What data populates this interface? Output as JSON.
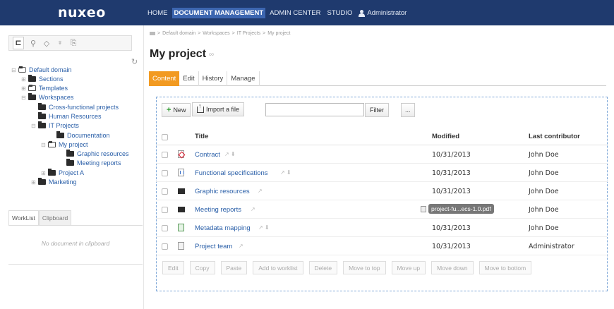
{
  "brand": "nuxeo",
  "topnav": {
    "items": [
      "HOME",
      "DOCUMENT MANAGEMENT",
      "ADMIN CENTER",
      "STUDIO"
    ],
    "active": "DOCUMENT MANAGEMENT",
    "user": "Administrator"
  },
  "tree_tabs": [
    "tree-icon",
    "search-icon",
    "tag-icon",
    "pin-icon",
    "clipboard-icon"
  ],
  "tree": [
    {
      "label": "Default domain",
      "depth": 0
    },
    {
      "label": "Sections",
      "depth": 1
    },
    {
      "label": "Templates",
      "depth": 1
    },
    {
      "label": "Workspaces",
      "depth": 1
    },
    {
      "label": "Cross-functional projects",
      "depth": 2
    },
    {
      "label": "Human Resources",
      "depth": 2
    },
    {
      "label": "IT Projects",
      "depth": 2
    },
    {
      "label": "Documentation",
      "depth": 3
    },
    {
      "label": "My project",
      "depth": 3
    },
    {
      "label": "Graphic resources",
      "depth": 4
    },
    {
      "label": "Meeting reports",
      "depth": 4
    },
    {
      "label": "Project A",
      "depth": 3
    },
    {
      "label": "Marketing",
      "depth": 2
    }
  ],
  "worklist": {
    "tabs": [
      "WorkList",
      "Clipboard"
    ],
    "empty_text": "No document in clipboard"
  },
  "breadcrumb": [
    "Default domain",
    "Workspaces",
    "IT Projects",
    "My project"
  ],
  "page_title": "My project",
  "doc_tabs": [
    "Content",
    "Edit",
    "History",
    "Manage"
  ],
  "toolbar": {
    "new_label": "New",
    "import_label": "Import a file",
    "filter_placeholder": "",
    "filter_label": "Filter",
    "more_label": "..."
  },
  "table": {
    "columns": [
      "Title",
      "Modified",
      "Last contributor"
    ],
    "rows": [
      {
        "title": "Contract",
        "type": "pdf",
        "modified": "10/31/2013",
        "contributor": "John Doe"
      },
      {
        "title": "Functional specifications",
        "type": "doc",
        "modified": "10/31/2013",
        "contributor": "John Doe"
      },
      {
        "title": "Graphic resources",
        "type": "folder",
        "modified": "10/31/2013",
        "contributor": "John Doe"
      },
      {
        "title": "Meeting reports",
        "type": "folder",
        "modified": "",
        "contributor": "John Doe"
      },
      {
        "title": "Metadata mapping",
        "type": "meta",
        "modified": "10/31/2013",
        "contributor": "John Doe"
      },
      {
        "title": "Project team",
        "type": "team",
        "modified": "10/31/2013",
        "contributor": "Administrator"
      }
    ]
  },
  "drag_chip": "project-fu...ecs-1.0.pdf",
  "actions": [
    "Edit",
    "Copy",
    "Paste",
    "Add to worklist",
    "Delete",
    "Move to top",
    "Move up",
    "Move down",
    "Move to bottom"
  ]
}
